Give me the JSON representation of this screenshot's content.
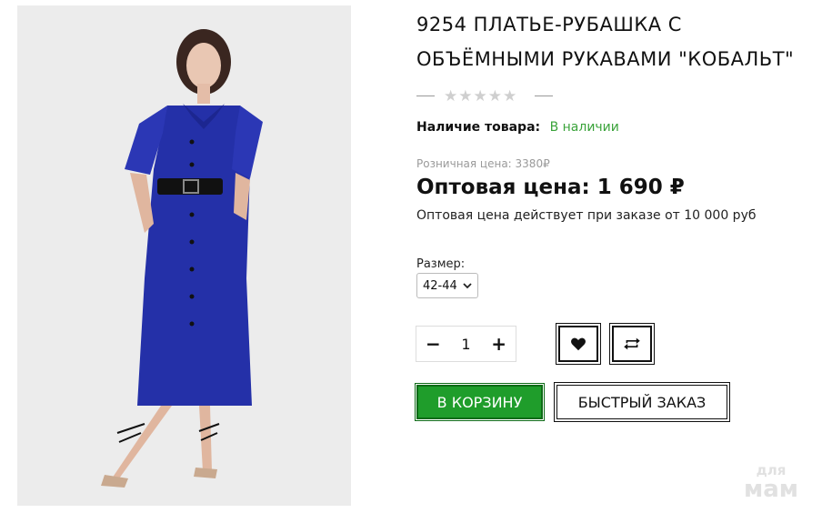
{
  "product": {
    "title": "9254 ПЛАТЬЕ-РУБАШКА С ОБЪЁМНЫМИ РУКАВАМИ \"КОБАЛЬТ\"",
    "rating_stars": "★★★★★",
    "availability_label": "Наличие товара:",
    "availability_value": "В наличии",
    "retail_price": "Розничная цена: 3380₽",
    "wholesale_price": "Оптовая цена: 1 690 ₽",
    "wholesale_note": "Оптовая цена действует при заказе от 10 000 руб",
    "size_label": "Размер:",
    "size_selected": "42-44",
    "quantity": "1",
    "minus": "−",
    "plus": "+",
    "add_to_cart": "В КОРЗИНУ",
    "quick_order": "БЫСТРЫЙ ЗАКАЗ"
  },
  "watermark": {
    "line1": "для",
    "line2": "мам"
  },
  "colors": {
    "accent_green": "#1f9d2b",
    "in_stock_green": "#3aa33a",
    "dress_blue": "#2430a8"
  },
  "icons": [
    "heart-icon",
    "compare-icon",
    "chevron-down-icon",
    "star-icon"
  ]
}
